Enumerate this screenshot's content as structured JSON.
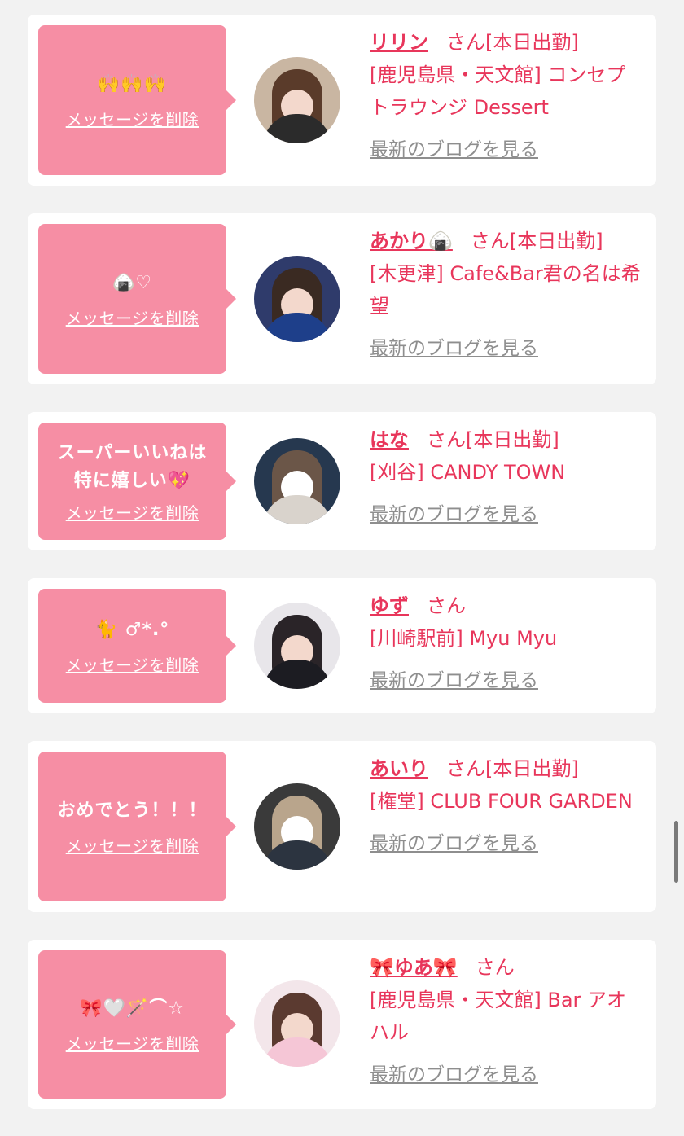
{
  "cards": [
    {
      "message": "🙌🙌🙌",
      "delete_label": "メッセージを削除",
      "name": "リリン",
      "san": "さん",
      "status": "[本日出勤]",
      "shop": "[鹿児島県・天文館] コンセプトラウンジ Dessert",
      "blog_label": "最新のブログを見る"
    },
    {
      "message": "🍙♡",
      "delete_label": "メッセージを削除",
      "name": "あかり🍙",
      "san": "さん",
      "status": "[本日出勤]",
      "shop": "[木更津] Cafe&Bar君の名は希望",
      "blog_label": "最新のブログを見る"
    },
    {
      "message": "スーパーいいねは\n特に嬉しい💖",
      "delete_label": "メッセージを削除",
      "name": "はな",
      "san": "さん",
      "status": "[本日出勤]",
      "shop": "[刈谷] CANDY TOWN",
      "blog_label": "最新のブログを見る"
    },
    {
      "message": "🐈 ♂*.°",
      "delete_label": "メッセージを削除",
      "name": "ゆず",
      "san": "さん",
      "status": "",
      "shop": "[川崎駅前] Myu Myu",
      "blog_label": "最新のブログを見る"
    },
    {
      "message": "おめでとう！！！",
      "delete_label": "メッセージを削除",
      "name": "あいり",
      "san": "さん",
      "status": "[本日出勤]",
      "shop": "[権堂] CLUB FOUR GARDEN",
      "blog_label": "最新のブログを見る"
    },
    {
      "message": "🎀🤍🪄⌒☆",
      "delete_label": "メッセージを削除",
      "name": "🎀ゆあ🎀",
      "san": "さん",
      "status": "",
      "shop": "[鹿児島県・天文館] Bar アオハル",
      "blog_label": "最新のブログを見る"
    }
  ],
  "colors": {
    "accent": "#e8365b",
    "bubble": "#f68ea4",
    "link_gray": "#8e8e8e",
    "background": "#f2f2f2"
  }
}
